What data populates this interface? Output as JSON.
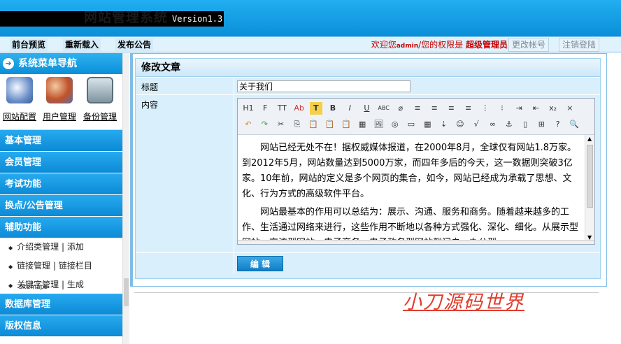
{
  "header": {
    "faint_title": "网站管理系统",
    "version": "Version1.3"
  },
  "topbar": {
    "buttons": [
      "前台预览",
      "重新载入",
      "发布公告"
    ],
    "welcome_prefix": "欢迎您",
    "username": "admin",
    "welcome_mid": "/您的权限是",
    "role": "超级管理员",
    "switch_account": "更改帐号",
    "logout": "注销登陆"
  },
  "sidebar": {
    "title": "系统菜单导航",
    "quick": [
      {
        "label": "网站配置",
        "icon": "gears-icon"
      },
      {
        "label": "用户管理",
        "icon": "users-icon"
      },
      {
        "label": "备份管理",
        "icon": "backup-icon"
      }
    ],
    "menus": [
      "基本管理",
      "会员管理",
      "考试功能",
      "换点/公告管理",
      "辅助功能"
    ],
    "sub_items": [
      {
        "a": "介绍类管理",
        "b": "添加"
      },
      {
        "a": "链接管理",
        "b": "链接栏目"
      },
      {
        "a": "关键字管理",
        "b": "生成",
        "c": "sitemaps"
      }
    ],
    "menus_bottom": [
      "数据库管理",
      "版权信息"
    ]
  },
  "main": {
    "panel_title": "修改文章",
    "title_label": "标题",
    "title_value": "关于我们",
    "content_label": "内容",
    "paragraphs": [
      "网站已经无处不在！据权威媒体报道，在2000年8月，全球仅有网站1.8万家。到2012年5月，网站数量达到5000万家，而四年多后的今天，这一数据则突破3亿家。10年前，网站的定义是多个网页的集合，如今，网站已经成为承载了思想、文化、行为方式的高级软件平台。",
      "网站最基本的作用可以总结为：展示、沟通、服务和商务。随着越来越多的工作、生活通过网络来进行，这些作用不断地以各种方式强化、深化、细化。从展示型网站、交流型网站、电子商务、电子政务型网站到门户、办公型"
    ],
    "submit": "编 辑",
    "watermark": "小刀源码世界"
  },
  "toolbar_row1": [
    "H1",
    "F",
    "TT",
    "Ab",
    "T",
    "B",
    "I",
    "U",
    "ABC",
    "⌀",
    "≡",
    "≡",
    "≡",
    "≡",
    "⋮",
    "⁝",
    "⇥",
    "⇤",
    "x₂",
    "×"
  ],
  "toolbar_row2": [
    "↶",
    "↷",
    "✂",
    "⎘",
    "📋",
    "📋",
    "📋",
    "▦",
    "🖼",
    "◎",
    "▭",
    "▦",
    "⇣",
    "☺",
    "√",
    "∞",
    "⚓",
    "▯",
    "⊞",
    "?",
    "🔍"
  ]
}
